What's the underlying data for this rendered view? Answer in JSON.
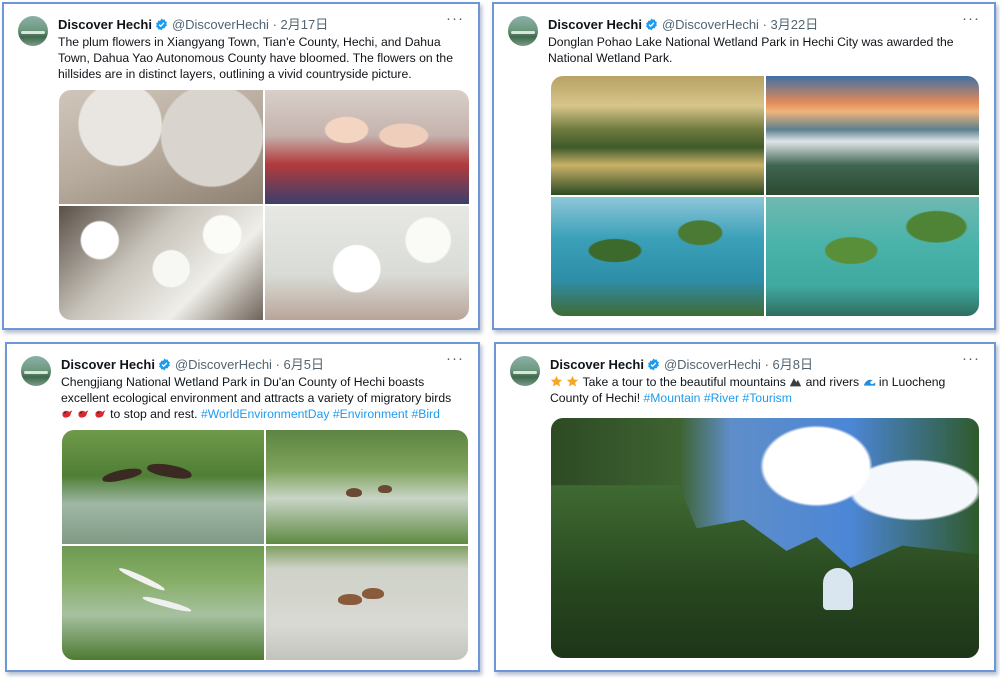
{
  "tweets": [
    {
      "name": "Discover Hechi",
      "handle": "@DiscoverHechi",
      "sep": "·",
      "date": "2月17日",
      "text": "The plum flowers in Xiangyang Town, Tian'e County, Hechi, and Dahua Town, Dahua Yao Autonomous County have bloomed. The flowers on the hillsides are in distinct layers, outlining a vivid countryside picture.",
      "more": "···"
    },
    {
      "name": "Discover Hechi",
      "handle": "@DiscoverHechi",
      "sep": "·",
      "date": "3月22日",
      "text": "Donglan Pohao Lake National Wetland Park in Hechi City was awarded the National Wetland Park.",
      "more": "···"
    },
    {
      "name": "Discover Hechi",
      "handle": "@DiscoverHechi",
      "sep": "·",
      "date": "6月5日",
      "text_a": "Chengjiang National Wetland Park in Du'an County of Hechi boasts excellent ecological environment and attracts a variety of migratory birds",
      "text_b": "to stop and rest.",
      "hashtags": [
        "#WorldEnvironmentDay",
        "#Environment",
        "#Bird"
      ],
      "more": "···"
    },
    {
      "name": "Discover Hechi",
      "handle": "@DiscoverHechi",
      "sep": "·",
      "date": "6月8日",
      "text_a": "Take a tour to the beautiful mountains",
      "text_b": "and rivers",
      "text_c": "in Luocheng County of Hechi!",
      "hashtags": [
        "#Mountain",
        "#River",
        "#Tourism"
      ],
      "more": "···"
    }
  ],
  "icons": {
    "verified": "verified-badge-icon",
    "more": "more-options-icon",
    "bird_emoji": "red-bird-emoji-icon",
    "star_emoji": "star-emoji-icon",
    "mountain_emoji": "mountain-emoji-icon",
    "wave_emoji": "water-wave-emoji-icon"
  },
  "colors": {
    "card_border": "#6f97d6",
    "hashtag": "#1d9bf0",
    "verified": "#1d9bf0",
    "muted": "#536471"
  }
}
